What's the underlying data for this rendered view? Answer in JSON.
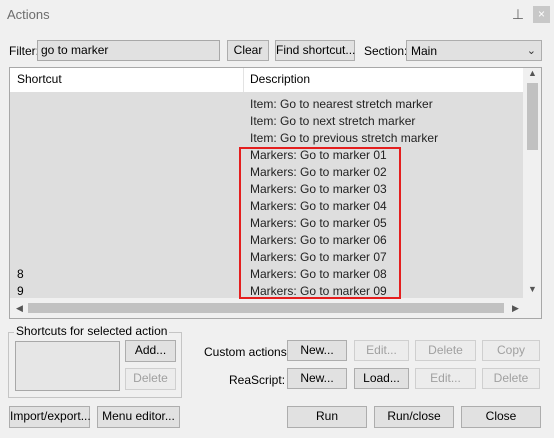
{
  "window": {
    "title": "Actions",
    "pin_glyph": "⊥",
    "close_glyph": "×"
  },
  "filter": {
    "label": "Filter:",
    "value": "go to marker",
    "clear_label": "Clear",
    "find_shortcut_label": "Find shortcut...",
    "section_label": "Section:",
    "section_value": "Main"
  },
  "list": {
    "columns": [
      "Shortcut",
      "Description"
    ],
    "rows": [
      {
        "shortcut": "",
        "description": "Item: Go to nearest stretch marker"
      },
      {
        "shortcut": "",
        "description": "Item: Go to next stretch marker"
      },
      {
        "shortcut": "",
        "description": "Item: Go to previous stretch marker"
      },
      {
        "shortcut": "",
        "description": "Markers: Go to marker 01"
      },
      {
        "shortcut": "",
        "description": "Markers: Go to marker 02"
      },
      {
        "shortcut": "",
        "description": "Markers: Go to marker 03"
      },
      {
        "shortcut": "",
        "description": "Markers: Go to marker 04"
      },
      {
        "shortcut": "",
        "description": "Markers: Go to marker 05"
      },
      {
        "shortcut": "",
        "description": "Markers: Go to marker 06"
      },
      {
        "shortcut": "",
        "description": "Markers: Go to marker 07"
      },
      {
        "shortcut": "8",
        "description": "Markers: Go to marker 08"
      },
      {
        "shortcut": "9",
        "description": "Markers: Go to marker 09"
      }
    ],
    "highlight_color": "#e41e1e"
  },
  "shortcuts_group": {
    "label": "Shortcuts for selected action",
    "add_label": "Add...",
    "delete_label": "Delete"
  },
  "custom_actions": {
    "label": "Custom actions:",
    "new_label": "New...",
    "edit_label": "Edit...",
    "delete_label": "Delete",
    "copy_label": "Copy"
  },
  "reascript": {
    "label": "ReaScript:",
    "new_label": "New...",
    "load_label": "Load...",
    "edit_label": "Edit...",
    "delete_label": "Delete"
  },
  "footer": {
    "import_export_label": "Import/export...",
    "menu_editor_label": "Menu editor...",
    "run_label": "Run",
    "run_close_label": "Run/close",
    "close_label": "Close"
  }
}
